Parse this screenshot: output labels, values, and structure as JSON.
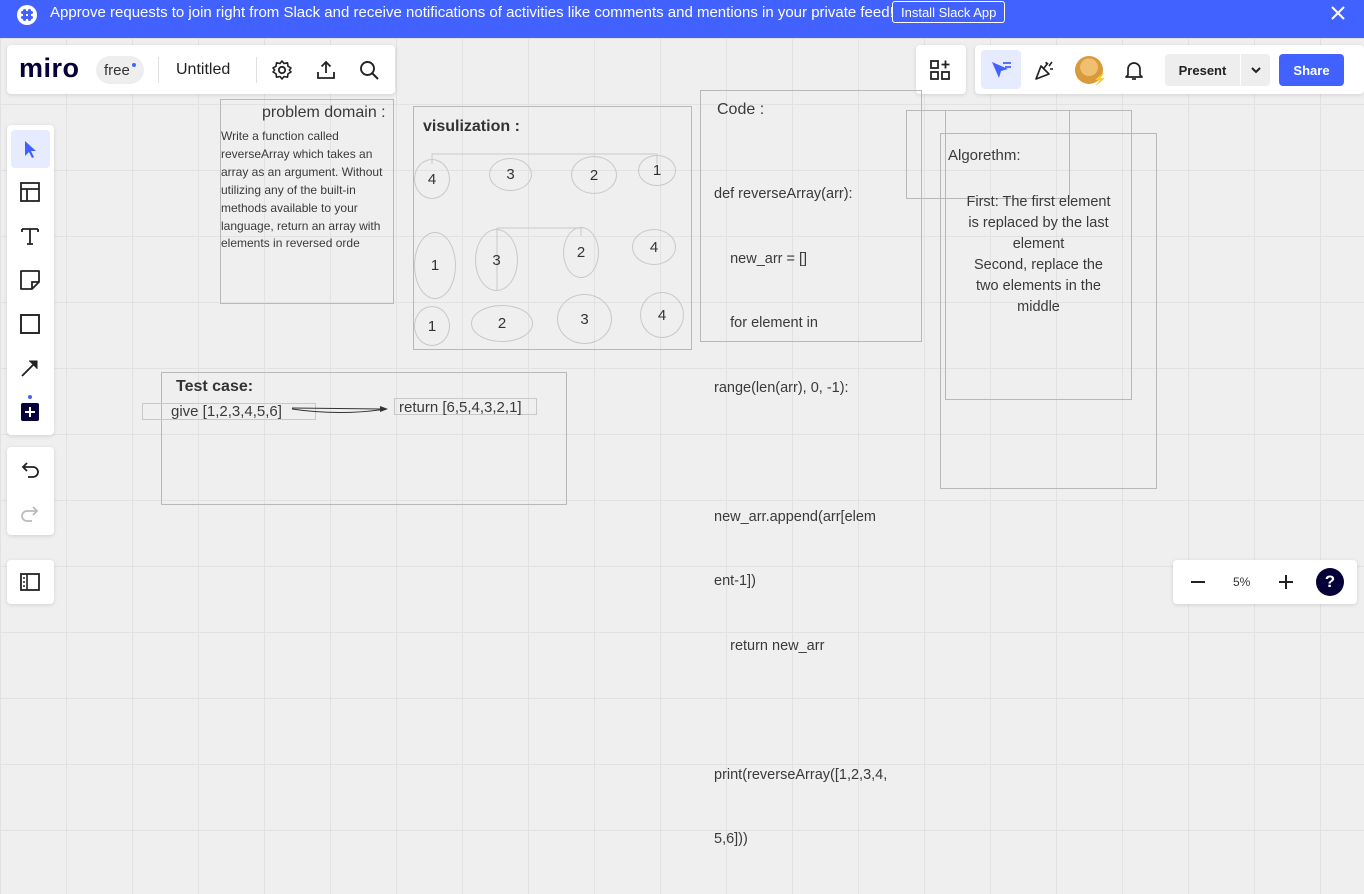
{
  "banner": {
    "message": "Approve requests to join right from Slack and receive notifications of activities like comments and mentions in your private feed!",
    "install_label": "Install Slack App",
    "color": "#4262ff"
  },
  "topbar": {
    "logo": "miro",
    "plan_badge": "free",
    "board_title": "Untitled",
    "icons": [
      "settings-icon",
      "upload-icon",
      "search-icon"
    ]
  },
  "rightbar": {
    "present_label": "Present",
    "share_label": "Share",
    "accent": "#4262ff",
    "icons": [
      "apps-icon",
      "cursor-select-icon",
      "celebration-icon",
      "avatar",
      "bell-icon",
      "chevron-down-icon"
    ]
  },
  "toolbar": {
    "tools": [
      "select-tool",
      "templates-tool",
      "text-tool",
      "sticky-note-tool",
      "shape-tool",
      "connector-tool",
      "add-more-tool"
    ],
    "undo": "undo",
    "redo": "redo"
  },
  "zoom": {
    "level": "5%",
    "help": "?"
  },
  "board": {
    "problem_domain": {
      "heading": "problem domain :",
      "lines": [
        "Write a function called",
        "reverseArray which takes an",
        "array as an argument. Without",
        "utilizing any of the built-in",
        "methods available to your",
        "language, return an array with",
        "elements in reversed orde"
      ]
    },
    "visualization": {
      "heading": "visulization :",
      "row1": [
        "4",
        "3",
        "2",
        "1"
      ],
      "row2": [
        "1",
        "3",
        "2",
        "4"
      ],
      "row3": [
        "1",
        "2",
        "3",
        "4"
      ]
    },
    "code": {
      "heading": "Code :",
      "lines": [
        "def reverseArray(arr):",
        "    new_arr = []",
        "    for element in",
        "range(len(arr), 0, -1):",
        "",
        "new_arr.append(arr[elem",
        "ent-1])",
        "    return new_arr",
        "",
        "print(reverseArray([1,2,3,4,",
        "5,6]))"
      ]
    },
    "algorithm": {
      "heading": "Algorethm:",
      "lines": [
        "First: The first element",
        "is replaced by the last",
        "element",
        "Second, replace the",
        "two elements in the",
        "middle"
      ]
    },
    "test_case": {
      "heading": "Test case:",
      "input": "give [1,2,3,4,5,6]",
      "output": "return [6,5,4,3,2,1]"
    }
  }
}
